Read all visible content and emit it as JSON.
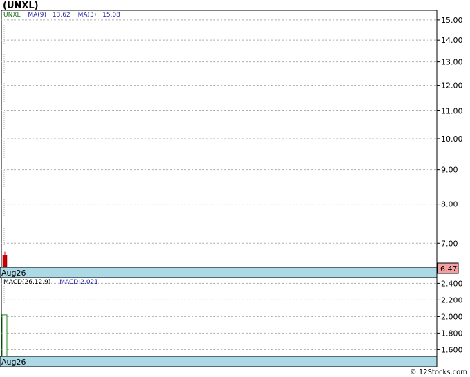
{
  "ticker_title": "(UNXL)",
  "footer_credit": "© 12Stocks.com",
  "colors": {
    "ticker": "#227722",
    "ma_label": "#2222aa",
    "date_band": "#add8e6",
    "last_price_bg": "#f4a0a0",
    "candle": "#cc0000",
    "macd_bar": "#228822",
    "grid": "#b0b0b0",
    "frame": "#000000"
  },
  "chart_data": [
    {
      "type": "candlestick",
      "legend": {
        "ticker": "UNXL",
        "ma9_label": "MA(9)",
        "ma9_value": "13.62",
        "ma3_label": "MA(3)",
        "ma3_value": "15.08"
      },
      "y_scale": "log",
      "ylim": [
        6.45,
        15.5
      ],
      "y_ticks": [
        "15.00",
        "14.00",
        "13.00",
        "12.00",
        "11.00",
        "10.00",
        "9.00",
        "8.00",
        "7.00"
      ],
      "y_tick_values": [
        15,
        14,
        13,
        12,
        11,
        10,
        9,
        8,
        7
      ],
      "x_label": "Aug26",
      "last_price": "6.47",
      "candles": [
        {
          "date": "Aug26",
          "open": 6.72,
          "high": 6.8,
          "low": 6.45,
          "close": 6.47
        }
      ],
      "grid": true
    },
    {
      "type": "bar",
      "legend": {
        "indicator": "MACD(26,12,9)",
        "value_label": "MACD:2.021"
      },
      "ylim": [
        1.52,
        2.47
      ],
      "y_ticks": [
        "2.400",
        "2.200",
        "2.000",
        "1.800",
        "1.600"
      ],
      "y_tick_values": [
        2.4,
        2.2,
        2.0,
        1.8,
        1.6
      ],
      "x_label": "Aug26",
      "bars": [
        {
          "date": "Aug26",
          "value": 2.021
        }
      ],
      "grid": true
    }
  ]
}
